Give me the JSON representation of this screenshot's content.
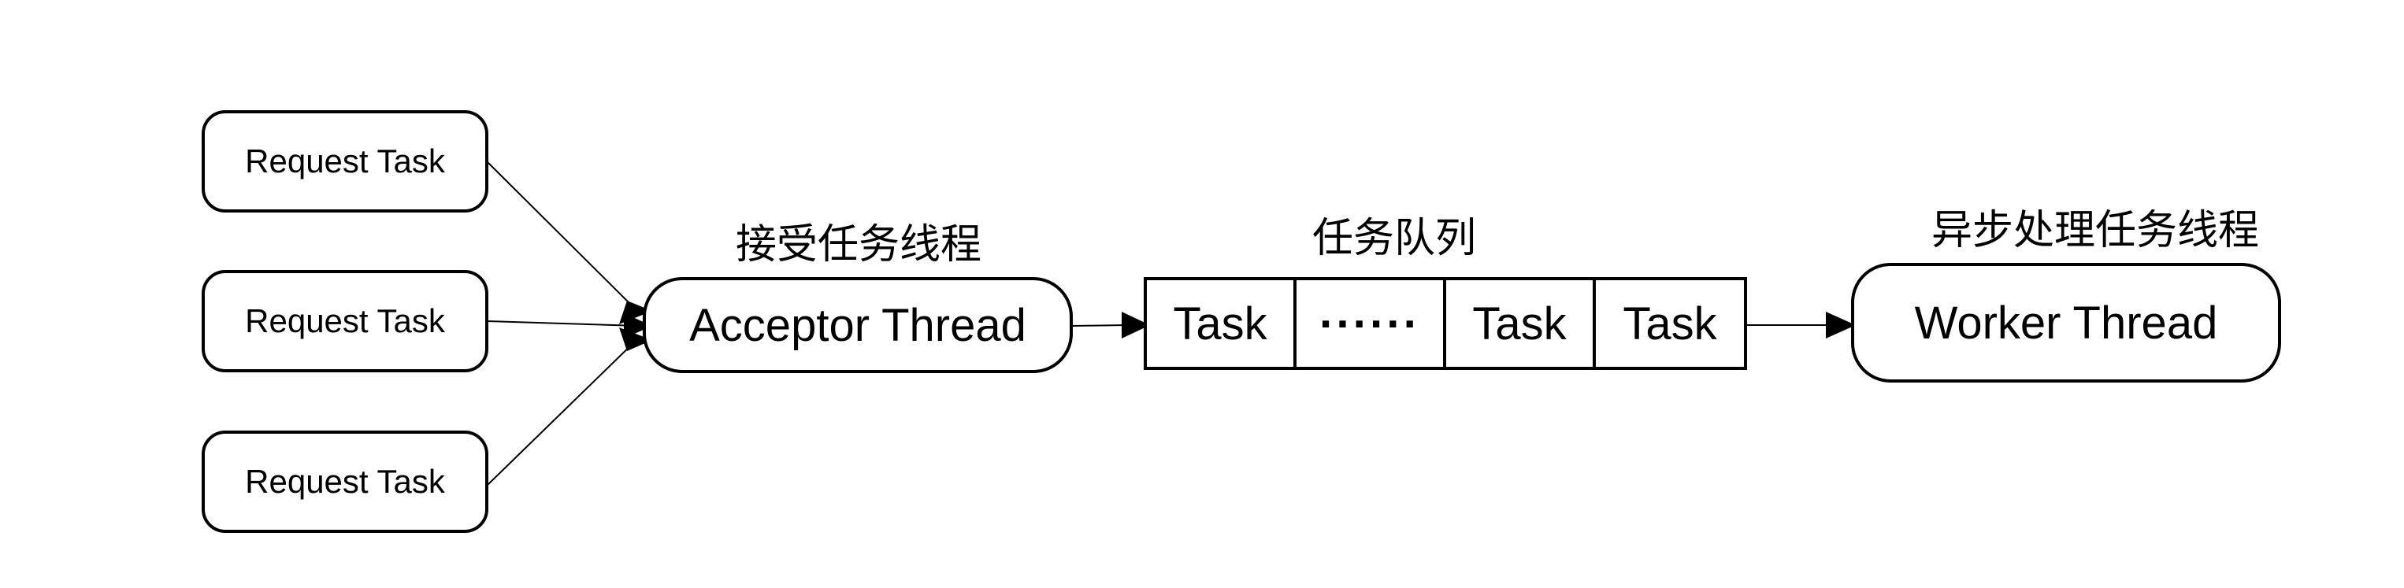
{
  "request_tasks": [
    {
      "label": "Request Task"
    },
    {
      "label": "Request Task"
    },
    {
      "label": "Request Task"
    }
  ],
  "acceptor": {
    "title": "接受任务线程",
    "label": "Acceptor Thread"
  },
  "queue": {
    "title": "任务队列",
    "cells": [
      "Task",
      "······",
      "Task",
      "Task"
    ]
  },
  "worker": {
    "title": "异步处理任务线程",
    "label": "Worker Thread"
  }
}
